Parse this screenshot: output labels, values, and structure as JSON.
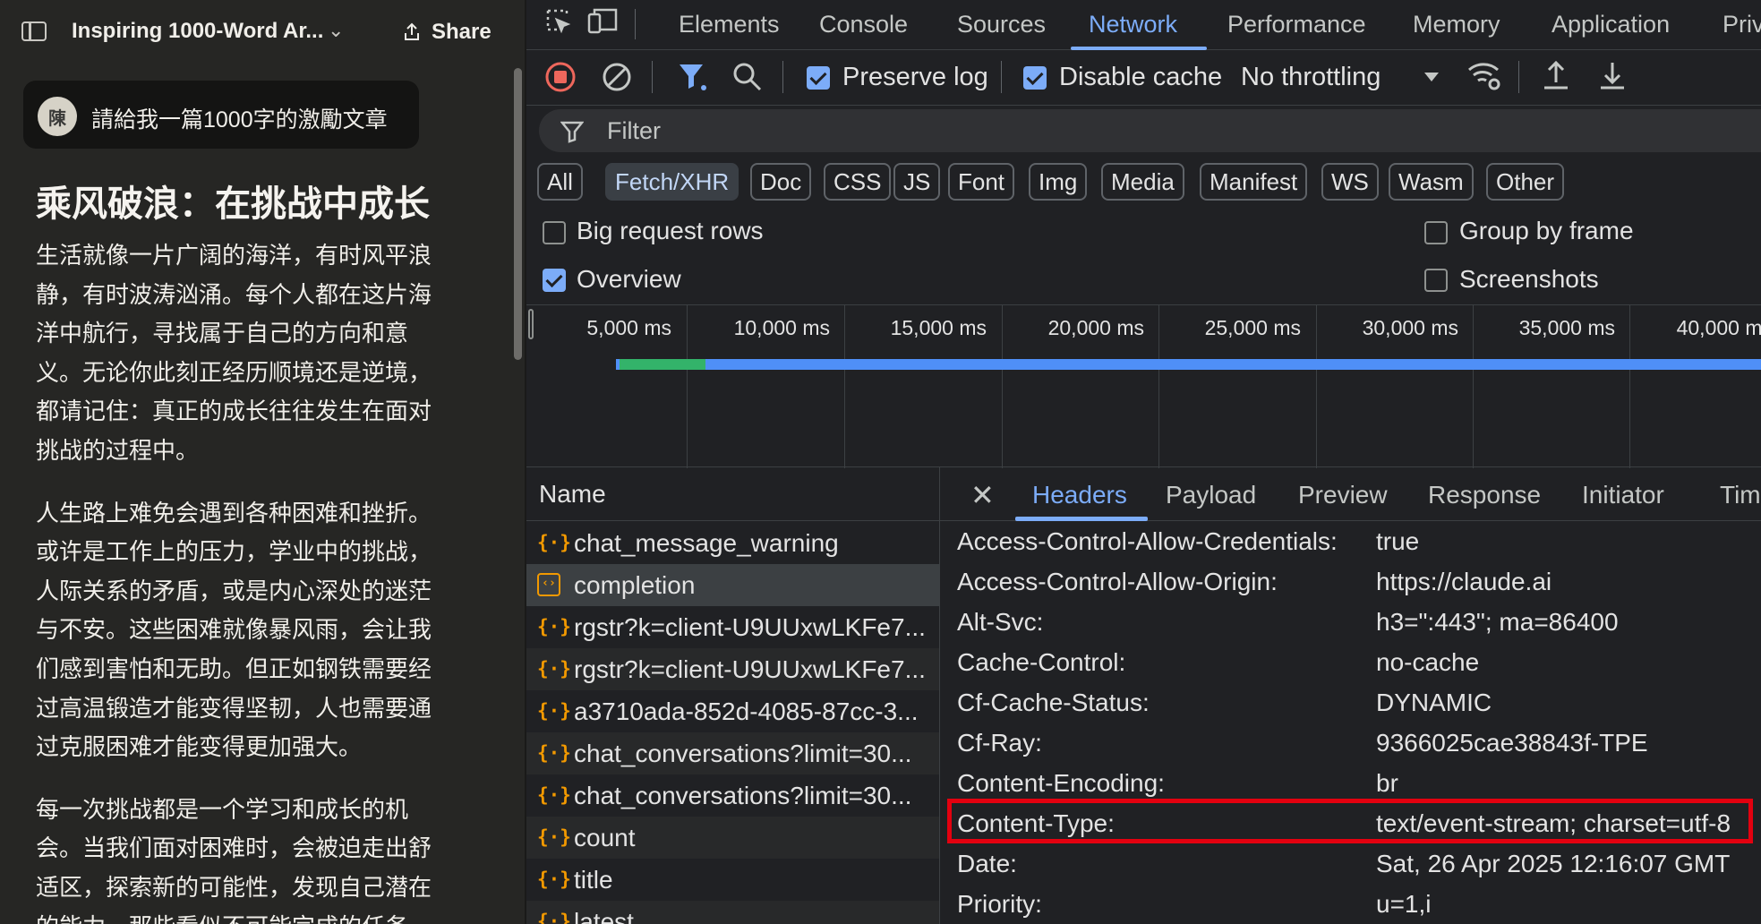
{
  "chat": {
    "title": "Inspiring 1000-Word Ar...",
    "share_label": "Share",
    "avatar_initial": "陳",
    "user_message": "請給我一篇1000字的激勵文章",
    "article_title": "乘风破浪：在挑战中成长",
    "paragraphs": [
      "生活就像一片广阔的海洋，有时风平浪静，有时波涛汹涌。每个人都在这片海洋中航行，寻找属于自己的方向和意义。无论你此刻正经历顺境还是逆境，都请记住：真正的成长往往发生在面对挑战的过程中。",
      "人生路上难免会遇到各种困难和挫折。或许是工作上的压力，学业中的挑战，人际关系的矛盾，或是内心深处的迷茫与不安。这些困难就像暴风雨，会让我们感到害怕和无助。但正如钢铁需要经过高温锻造才能变得坚韧，人也需要通过克服困难才能变得更加强大。",
      "每一次挑战都是一个学习和成长的机会。当我们面对困难时，会被迫走出舒适区，探索新的可能性，发现自己潜在的能力。那些看似不可能完成的任务，"
    ]
  },
  "devtools": {
    "panel_tabs": [
      "Elements",
      "Console",
      "Sources",
      "Network",
      "Performance",
      "Memory",
      "Application",
      "Priv"
    ],
    "active_tab": "Network",
    "toolbar": {
      "preserve_log": "Preserve log",
      "preserve_log_checked": true,
      "disable_cache": "Disable cache",
      "disable_cache_checked": true,
      "throttling": "No throttling"
    },
    "filter_placeholder": "Filter",
    "type_filters": [
      "All",
      "Fetch/XHR",
      "Doc",
      "CSS",
      "JS",
      "Font",
      "Img",
      "Media",
      "Manifest",
      "WS",
      "Wasm",
      "Other"
    ],
    "active_type_filter": "Fetch/XHR",
    "options": {
      "big_request_rows": "Big request rows",
      "big_request_rows_checked": false,
      "group_by_frame": "Group by frame",
      "group_by_frame_checked": false,
      "overview": "Overview",
      "overview_checked": true,
      "screenshots": "Screenshots",
      "screenshots_checked": false
    },
    "timeline_ticks": [
      "5,000 ms",
      "10,000 ms",
      "15,000 ms",
      "20,000 ms",
      "25,000 ms",
      "30,000 ms",
      "35,000 ms",
      "40,000 ms"
    ],
    "name_column": "Name",
    "requests": [
      {
        "name": "chat_message_warning",
        "icon": "xhr-icon"
      },
      {
        "name": "completion",
        "icon": "doc-icon",
        "selected": true
      },
      {
        "name": "rgstr?k=client-U9UUxwLKFe7...",
        "icon": "xhr-icon"
      },
      {
        "name": "rgstr?k=client-U9UUxwLKFe7...",
        "icon": "xhr-icon"
      },
      {
        "name": "a3710ada-852d-4085-87cc-3...",
        "icon": "xhr-icon"
      },
      {
        "name": "chat_conversations?limit=30...",
        "icon": "xhr-icon"
      },
      {
        "name": "chat_conversations?limit=30...",
        "icon": "xhr-icon"
      },
      {
        "name": "count",
        "icon": "xhr-icon"
      },
      {
        "name": "title",
        "icon": "xhr-icon"
      },
      {
        "name": "latest",
        "icon": "xhr-icon"
      }
    ],
    "detail_tabs": [
      "Headers",
      "Payload",
      "Preview",
      "Response",
      "Initiator",
      "Timi"
    ],
    "active_detail_tab": "Headers",
    "headers": [
      {
        "key": "Access-Control-Allow-Credentials:",
        "value": "true"
      },
      {
        "key": "Access-Control-Allow-Origin:",
        "value": "https://claude.ai"
      },
      {
        "key": "Alt-Svc:",
        "value": "h3=\":443\"; ma=86400"
      },
      {
        "key": "Cache-Control:",
        "value": "no-cache"
      },
      {
        "key": "Cf-Cache-Status:",
        "value": "DYNAMIC"
      },
      {
        "key": "Cf-Ray:",
        "value": "9366025cae38843f-TPE"
      },
      {
        "key": "Content-Encoding:",
        "value": "br"
      },
      {
        "key": "Content-Type:",
        "value": "text/event-stream; charset=utf-8",
        "highlighted": true
      },
      {
        "key": "Date:",
        "value": "Sat, 26 Apr 2025 12:16:07 GMT"
      },
      {
        "key": "Priority:",
        "value": "u=1,i"
      }
    ],
    "colors": {
      "accent": "#7cacf8",
      "highlight_border": "#e3000f",
      "timeline_green": "#33b36a",
      "timeline_blue": "#4f8ff7",
      "xhr_icon": "#f29900"
    }
  }
}
